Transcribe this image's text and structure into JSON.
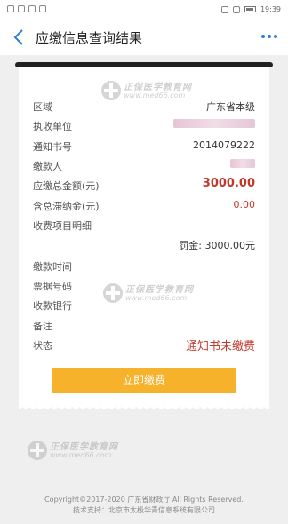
{
  "status_bar": {
    "time": "19:39"
  },
  "nav": {
    "back_icon": "chevron-left-icon",
    "title": "应缴信息查询结果",
    "more_icon": "more-icon"
  },
  "watermark": {
    "line1": "正保医学教育网",
    "line2": "www.med66.com"
  },
  "receipt": {
    "rows": [
      {
        "label": "区域",
        "value": "广东省本级"
      },
      {
        "label": "执收单位",
        "value": ""
      },
      {
        "label": "通知书号",
        "value": "2014079222"
      },
      {
        "label": "缴款人",
        "value": ""
      },
      {
        "label": "应缴总金额(元)",
        "value": "3000.00"
      },
      {
        "label": "含总滞纳金(元)",
        "value": "0.00"
      },
      {
        "label": "收费项目明细",
        "value": ""
      },
      {
        "label": "缴款时间",
        "value": ""
      },
      {
        "label": "票据号码",
        "value": ""
      },
      {
        "label": "收款银行",
        "value": ""
      },
      {
        "label": "备注",
        "value": ""
      },
      {
        "label": "状态",
        "value": "通知书未缴费"
      }
    ],
    "fine": "罚金: 3000.00元",
    "pay_button": "立即缴费"
  },
  "footer": {
    "copyright": "Copyright©2017-2020 广东省财政厅 All Rights Reserved.",
    "support": "技术支持：北京市太极华青信息系统有限公司"
  },
  "colors": {
    "accent": "#2a7fd4",
    "amount_red": "#c0392b",
    "button": "#f7b22b"
  }
}
